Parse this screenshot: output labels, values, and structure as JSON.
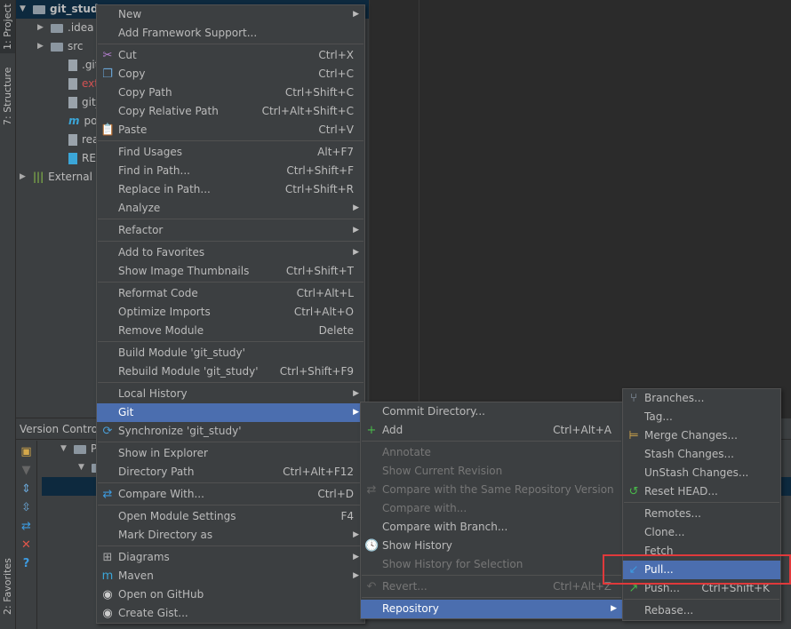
{
  "sidebar_tabs": {
    "project": "1: Project",
    "structure": "7: Structure",
    "favorites": "2: Favorites"
  },
  "project_tree": [
    {
      "label": "git_study",
      "type": "module",
      "indent": 0,
      "expanded": true,
      "selected": true
    },
    {
      "label": ".idea",
      "type": "folder",
      "indent": 1
    },
    {
      "label": "src",
      "type": "folder",
      "indent": 1
    },
    {
      "label": ".gitig",
      "type": "file",
      "indent": 2
    },
    {
      "label": "extra",
      "type": "file",
      "indent": 2,
      "color": "#d25252"
    },
    {
      "label": "git_st",
      "type": "file",
      "indent": 2
    },
    {
      "label": "pom.",
      "type": "maven",
      "indent": 2
    },
    {
      "label": "read",
      "type": "file",
      "indent": 2
    },
    {
      "label": "READ",
      "type": "md",
      "indent": 2
    },
    {
      "label": "External",
      "type": "lib",
      "indent": 0
    }
  ],
  "version_control": {
    "title": "Version Control:",
    "tree": [
      "Pull",
      ""
    ]
  },
  "main_menu": [
    {
      "label": "New",
      "sub": true
    },
    {
      "label": "Add Framework Support..."
    },
    {
      "sep": true
    },
    {
      "label": "Cut",
      "shortcut": "Ctrl+X",
      "icon": "✂",
      "icon_name": "scissors-icon",
      "icon_color": "#b57fd0"
    },
    {
      "label": "Copy",
      "shortcut": "Ctrl+C",
      "icon": "❐",
      "icon_name": "copy-icon",
      "icon_color": "#6aa6d6"
    },
    {
      "label": "Copy Path",
      "shortcut": "Ctrl+Shift+C"
    },
    {
      "label": "Copy Relative Path",
      "shortcut": "Ctrl+Alt+Shift+C"
    },
    {
      "label": "Paste",
      "shortcut": "Ctrl+V",
      "icon": "📋",
      "icon_name": "paste-icon",
      "icon_color": "#d4a84b"
    },
    {
      "sep": true
    },
    {
      "label": "Find Usages",
      "shortcut": "Alt+F7"
    },
    {
      "label": "Find in Path...",
      "shortcut": "Ctrl+Shift+F"
    },
    {
      "label": "Replace in Path...",
      "shortcut": "Ctrl+Shift+R"
    },
    {
      "label": "Analyze",
      "sub": true
    },
    {
      "sep": true
    },
    {
      "label": "Refactor",
      "sub": true
    },
    {
      "sep": true
    },
    {
      "label": "Add to Favorites",
      "sub": true
    },
    {
      "label": "Show Image Thumbnails",
      "shortcut": "Ctrl+Shift+T"
    },
    {
      "sep": true
    },
    {
      "label": "Reformat Code",
      "shortcut": "Ctrl+Alt+L"
    },
    {
      "label": "Optimize Imports",
      "shortcut": "Ctrl+Alt+O"
    },
    {
      "label": "Remove Module",
      "shortcut": "Delete"
    },
    {
      "sep": true
    },
    {
      "label": "Build Module 'git_study'"
    },
    {
      "label": "Rebuild Module 'git_study'",
      "shortcut": "Ctrl+Shift+F9"
    },
    {
      "sep": true
    },
    {
      "label": "Local History",
      "sub": true
    },
    {
      "label": "Git",
      "sub": true,
      "highlight": true
    },
    {
      "label": "Synchronize 'git_study'",
      "icon": "⟳",
      "icon_name": "sync-icon",
      "icon_color": "#4a9fd8"
    },
    {
      "sep": true
    },
    {
      "label": "Show in Explorer"
    },
    {
      "label": "Directory Path",
      "shortcut": "Ctrl+Alt+F12"
    },
    {
      "sep": true
    },
    {
      "label": "Compare With...",
      "shortcut": "Ctrl+D",
      "icon": "⇄",
      "icon_name": "compare-icon",
      "icon_color": "#3d9be0"
    },
    {
      "sep": true
    },
    {
      "label": "Open Module Settings",
      "shortcut": "F4"
    },
    {
      "label": "Mark Directory as",
      "sub": true
    },
    {
      "sep": true
    },
    {
      "label": "Diagrams",
      "sub": true,
      "icon": "⊞",
      "icon_name": "diagram-icon",
      "icon_color": "#aaa"
    },
    {
      "label": "Maven",
      "sub": true,
      "icon": "m",
      "icon_name": "maven-icon",
      "icon_color": "#3ba6d8"
    },
    {
      "label": "Open on GitHub",
      "icon": "◉",
      "icon_name": "github-icon",
      "icon_color": "#ccc"
    },
    {
      "label": "Create Gist...",
      "icon": "◉",
      "icon_name": "github-icon",
      "icon_color": "#ccc"
    }
  ],
  "git_menu": [
    {
      "label": "Commit Directory..."
    },
    {
      "label": "Add",
      "shortcut": "Ctrl+Alt+A",
      "icon": "+",
      "icon_name": "plus-icon",
      "icon_color": "#49b84a"
    },
    {
      "sep": true
    },
    {
      "label": "Annotate",
      "disabled": true
    },
    {
      "label": "Show Current Revision",
      "disabled": true
    },
    {
      "label": "Compare with the Same Repository Version",
      "disabled": true,
      "icon": "⇄",
      "icon_name": "compare-icon",
      "icon_color": "#666"
    },
    {
      "label": "Compare with...",
      "disabled": true
    },
    {
      "label": "Compare with Branch..."
    },
    {
      "label": "Show History",
      "icon": "🕓",
      "icon_name": "history-icon",
      "icon_color": "#6aa6d6"
    },
    {
      "label": "Show History for Selection",
      "disabled": true
    },
    {
      "sep": true
    },
    {
      "label": "Revert...",
      "shortcut": "Ctrl+Alt+Z",
      "disabled": true,
      "icon": "↶",
      "icon_name": "revert-icon",
      "icon_color": "#666"
    },
    {
      "sep": true
    },
    {
      "label": "Repository",
      "sub": true,
      "highlight": true
    }
  ],
  "repository_menu": [
    {
      "label": "Branches...",
      "icon": "⑂",
      "icon_name": "branches-icon",
      "icon_color": "#9ab"
    },
    {
      "label": "Tag..."
    },
    {
      "label": "Merge Changes...",
      "icon": "⊨",
      "icon_name": "merge-icon",
      "icon_color": "#d4a84b"
    },
    {
      "label": "Stash Changes..."
    },
    {
      "label": "UnStash Changes..."
    },
    {
      "label": "Reset HEAD...",
      "icon": "↺",
      "icon_name": "reset-icon",
      "icon_color": "#49b84a"
    },
    {
      "sep": true
    },
    {
      "label": "Remotes..."
    },
    {
      "label": "Clone..."
    },
    {
      "label": "Fetch"
    },
    {
      "label": "Pull...",
      "highlight": true,
      "icon": "↙",
      "icon_name": "pull-icon",
      "icon_color": "#3d9be0"
    },
    {
      "label": "Push...",
      "shortcut": "Ctrl+Shift+K",
      "icon": "↗",
      "icon_name": "push-icon",
      "icon_color": "#49b84a"
    },
    {
      "sep": true
    },
    {
      "label": "Rebase..."
    }
  ]
}
